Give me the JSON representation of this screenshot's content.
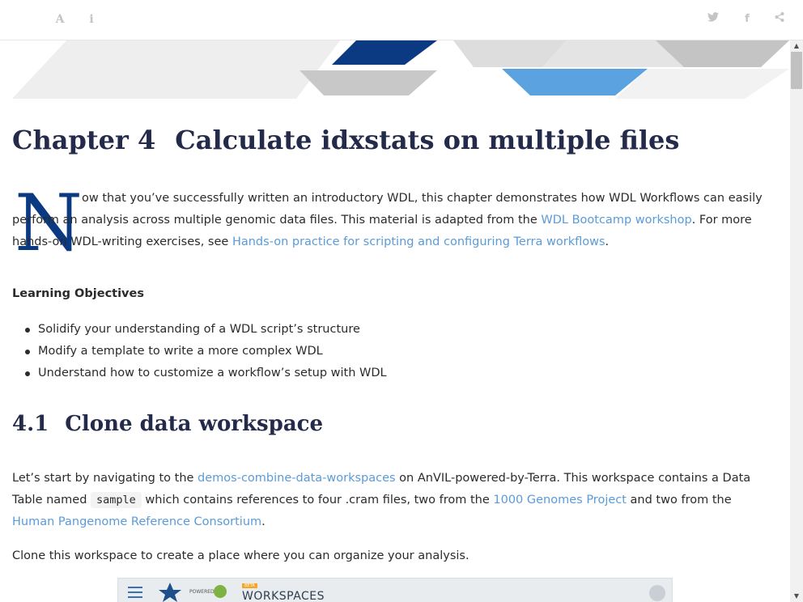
{
  "toolbar": {
    "font_glyph": "A",
    "info_glyph": "i",
    "twitter_glyph": "🐦",
    "facebook_glyph": "f",
    "share_glyph": "⋖",
    "icons": [
      "font-settings-icon",
      "info-icon",
      "twitter-icon",
      "facebook-icon",
      "share-icon"
    ]
  },
  "colors": {
    "heading": "#242a4a",
    "link": "#5a9bd8",
    "dropcap": "#0b3a83",
    "banner_navy": "#0b3a83",
    "banner_blue": "#5aa2e0",
    "banner_grey": "#c4c4c4"
  },
  "chapter": {
    "number": "Chapter 4",
    "title": "Calculate idxstats on multiple files"
  },
  "intro": {
    "dropcap": "N",
    "text_1": "ow that you’ve successfully written an introductory WDL, this chapter demonstrates how WDL Workflows can easily perform an analysis across multiple genomic data files. This material is adapted from the ",
    "link_1": "WDL Bootcamp workshop",
    "text_2": ". For more hands-on WDL-writing exercises, see ",
    "link_2": "Hands-on practice for scripting and configuring Terra workflows",
    "text_3": "."
  },
  "objectives": {
    "heading": "Learning Objectives",
    "items": [
      "Solidify your understanding of a WDL script’s structure",
      "Modify a template to write a more complex WDL",
      "Understand how to customize a workflow’s setup with WDL"
    ]
  },
  "section": {
    "number": "4.1",
    "title": "Clone data workspace"
  },
  "clone": {
    "text_1": "Let’s start by navigating to the ",
    "link_1": "demos-combine-data-workspaces",
    "text_2": " on AnVIL-powered-by-Terra. This workspace contains a Data Table named ",
    "code": "sample",
    "text_3": " which contains references to four .cram files, two from the ",
    "link_2": "1000 Genomes Project",
    "text_4": " and two from the ",
    "link_3": "Human Pangenome Reference Consortium",
    "text_5": ".",
    "instruction": "Clone this workspace to create a place where you can organize your analysis."
  },
  "screenshot": {
    "powered_by": "POWERED BY",
    "beta": "BETA",
    "workspaces": "WORKSPACES"
  },
  "scrollbar": {
    "up": "▲",
    "down": "▼"
  }
}
